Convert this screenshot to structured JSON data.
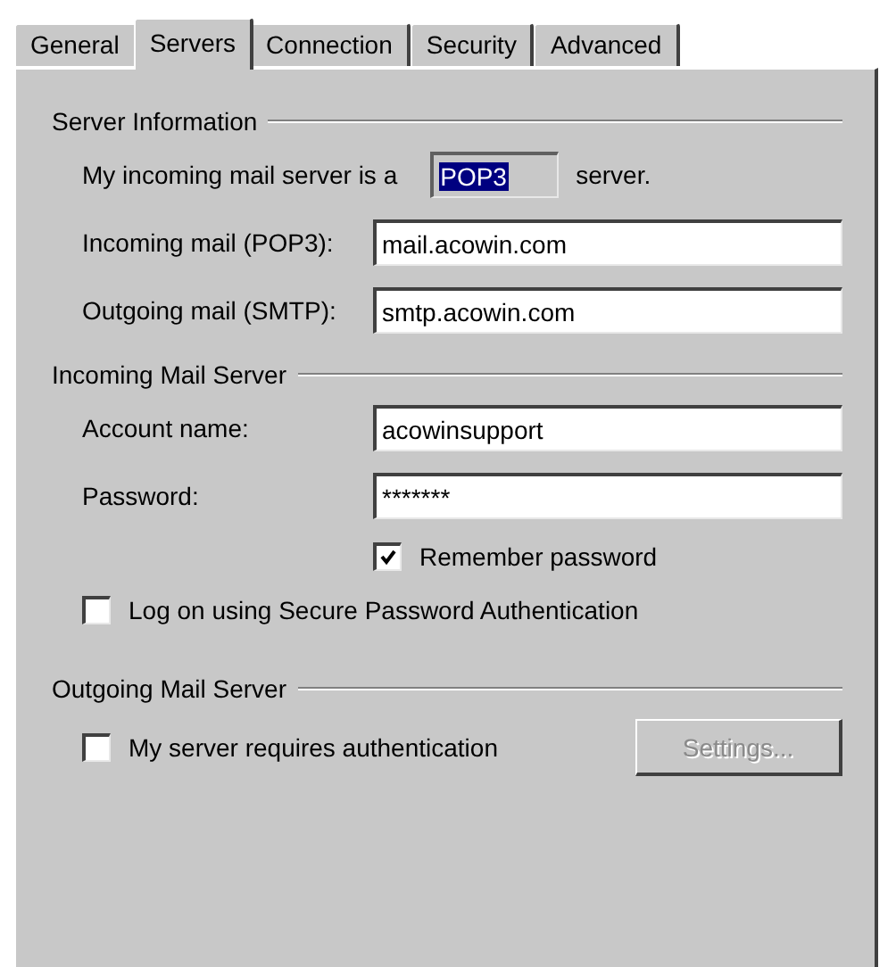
{
  "tabs": [
    {
      "label": "General",
      "selected": false
    },
    {
      "label": "Servers",
      "selected": true
    },
    {
      "label": "Connection",
      "selected": false
    },
    {
      "label": "Security",
      "selected": false
    },
    {
      "label": "Advanced",
      "selected": false
    }
  ],
  "server_information": {
    "title": "Server Information",
    "server_type_prefix": "My incoming mail server is a",
    "server_type": "POP3",
    "server_type_suffix": "server.",
    "fields": [
      {
        "label": "Incoming mail (POP3):",
        "value": "mail.acowin.com"
      },
      {
        "label": "Outgoing mail (SMTP):",
        "value": "smtp.acowin.com"
      }
    ]
  },
  "incoming_mail_server": {
    "title": "Incoming Mail Server",
    "fields": [
      {
        "label": "Account name:",
        "value": "acowinsupport"
      },
      {
        "label": "Password:",
        "value": "*******"
      }
    ],
    "remember_password": {
      "label": "Remember password",
      "checked": true
    },
    "secure_password_authentication": {
      "label": "Log on using Secure Password Authentication",
      "checked": false
    }
  },
  "outgoing_mail_server": {
    "title": "Outgoing Mail Server",
    "requires_authentication": {
      "label": "My server requires authentication",
      "checked": false
    },
    "settings_button": {
      "label": "Settings...",
      "disabled": true
    }
  }
}
